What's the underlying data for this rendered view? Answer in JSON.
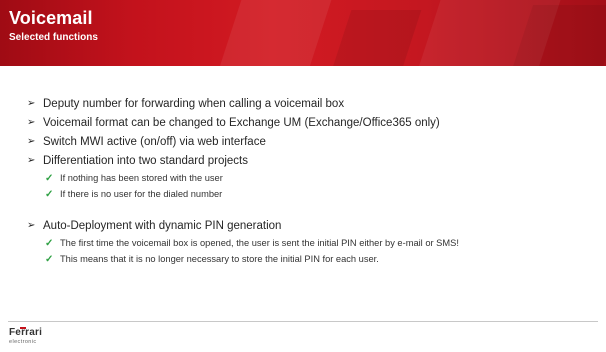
{
  "header": {
    "title": "Voicemail",
    "subtitle": "Selected functions"
  },
  "content": {
    "bullets": [
      "Deputy number for forwarding when calling a voicemail box",
      "Voicemail format can be changed to Exchange UM (Exchange/Office365 only)",
      "Switch MWI active (on/off) via web interface",
      "Differentiation into two standard projects"
    ],
    "differentiation_items": [
      "If nothing has been stored with the user",
      "If there is no user for the dialed number"
    ],
    "auto_deployment": {
      "label": "Auto-Deployment with dynamic PIN generation",
      "items": [
        "The first time the voicemail box is opened, the user is sent the initial PIN either by e-mail or SMS!",
        "This means that it is no longer necessary to store the initial PIN for each user."
      ]
    }
  },
  "footer": {
    "logo_name": "Ferrari",
    "logo_sub": "electronic"
  },
  "colors": {
    "header_red": "#c3121c",
    "check_green": "#2ea043",
    "text": "#262626"
  },
  "icons": {
    "bullet": "arrowhead-bullet-icon",
    "sub_bullet": "checkmark-icon"
  }
}
